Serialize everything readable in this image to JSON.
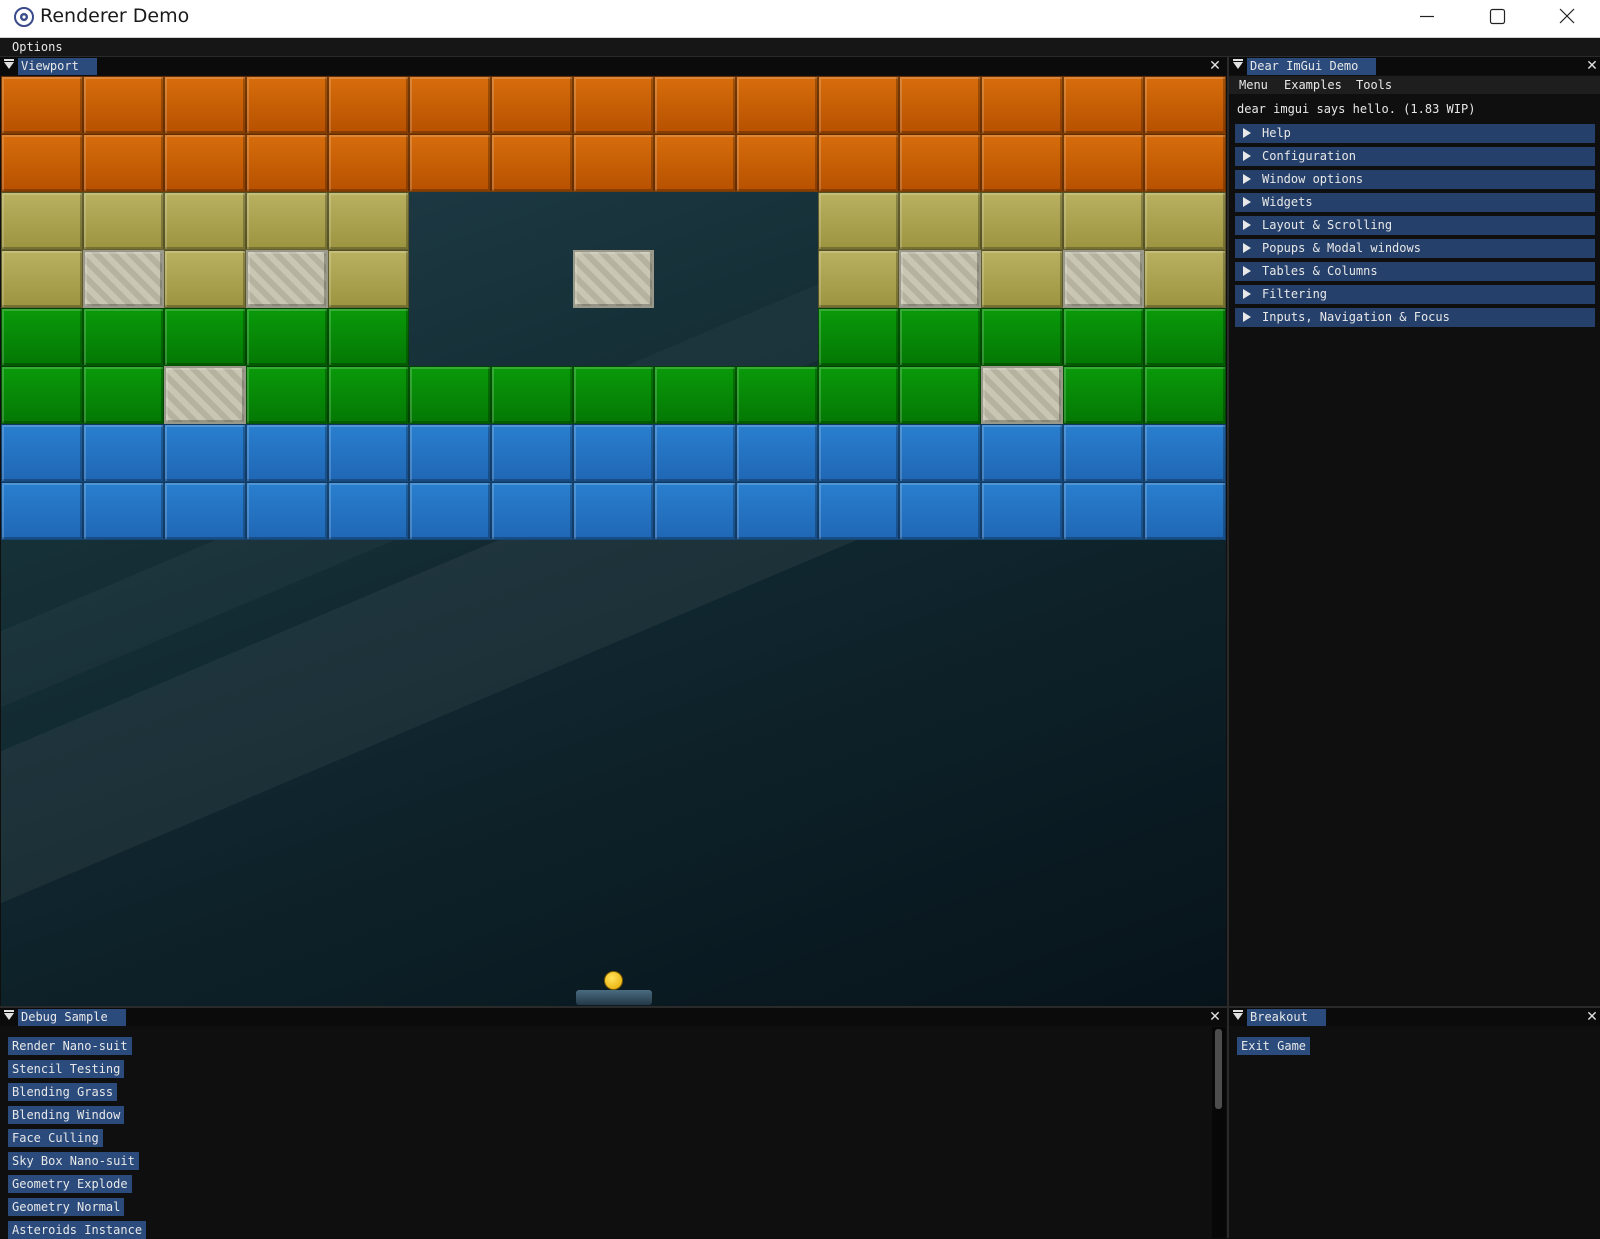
{
  "window": {
    "title": "Renderer Demo",
    "icon": "app-logo-icon"
  },
  "menubar": {
    "items": [
      "Options"
    ]
  },
  "viewport": {
    "title": "Viewport"
  },
  "game": {
    "brick_rows": [
      [
        "orange",
        "orange",
        "orange",
        "orange",
        "orange",
        "orange",
        "orange",
        "orange",
        "orange",
        "orange",
        "orange",
        "orange",
        "orange",
        "orange",
        "orange"
      ],
      [
        "orange",
        "orange",
        "orange",
        "orange",
        "orange",
        "orange",
        "orange",
        "orange",
        "orange",
        "orange",
        "orange",
        "orange",
        "orange",
        "orange",
        "orange"
      ],
      [
        "olive",
        "olive",
        "olive",
        "olive",
        "olive",
        "",
        "",
        "",
        "",
        "",
        "olive",
        "olive",
        "olive",
        "olive",
        "olive"
      ],
      [
        "olive",
        "solid",
        "olive",
        "solid",
        "olive",
        "",
        "",
        "solid",
        "",
        "",
        "olive",
        "solid",
        "olive",
        "solid",
        "olive"
      ],
      [
        "green",
        "green",
        "green",
        "green",
        "green",
        "",
        "",
        "",
        "",
        "",
        "green",
        "green",
        "green",
        "green",
        "green"
      ],
      [
        "green",
        "green",
        "solid",
        "green",
        "green",
        "green",
        "green",
        "green",
        "green",
        "green",
        "green",
        "green",
        "solid",
        "green",
        "green"
      ],
      [
        "blue",
        "blue",
        "blue",
        "blue",
        "blue",
        "blue",
        "blue",
        "blue",
        "blue",
        "blue",
        "blue",
        "blue",
        "blue",
        "blue",
        "blue"
      ],
      [
        "blue",
        "blue",
        "blue",
        "blue",
        "blue",
        "blue",
        "blue",
        "blue",
        "blue",
        "blue",
        "blue",
        "blue",
        "blue",
        "blue",
        "blue"
      ]
    ],
    "colors": {
      "orange": "#c75f05",
      "olive": "#aba350",
      "green": "#088808",
      "blue": "#2473c2",
      "solid": "#c1beac"
    }
  },
  "demo": {
    "title": "Dear ImGui Demo",
    "menu": [
      "Menu",
      "Examples",
      "Tools"
    ],
    "hello": "dear imgui says hello. (1.83 WIP)",
    "headers": [
      "Help",
      "Configuration",
      "Window options",
      "Widgets",
      "Layout & Scrolling",
      "Popups & Modal windows",
      "Tables & Columns",
      "Filtering",
      "Inputs, Navigation & Focus"
    ]
  },
  "debug": {
    "title": "Debug Sample",
    "buttons": [
      "Render Nano-suit",
      "Stencil Testing",
      "Blending Grass",
      "Blending Window",
      "Face Culling",
      "Sky Box Nano-suit",
      "Geometry Explode",
      "Geometry Normal",
      "Asteroids Instance"
    ]
  },
  "breakout": {
    "title": "Breakout",
    "exit_label": "Exit Game"
  },
  "accent": "#2a4b7c"
}
